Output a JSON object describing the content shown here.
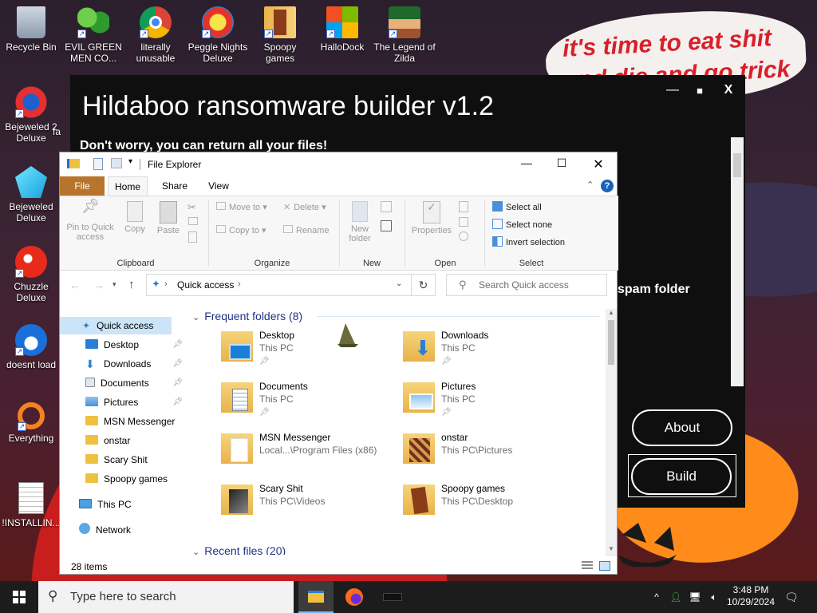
{
  "desktop": {
    "icons": [
      {
        "label": "Recycle Bin",
        "icon": "recycle-bin-icon"
      },
      {
        "label": "EVIL GREEN MEN CO...",
        "icon": "msn-icon"
      },
      {
        "label": "literally unusable",
        "icon": "chrome-icon"
      },
      {
        "label": "Peggle Nights Deluxe",
        "icon": "peggle-icon"
      },
      {
        "label": "Spoopy games",
        "icon": "folder-icon"
      },
      {
        "label": "HalloDock",
        "icon": "windows-logo-icon"
      },
      {
        "label": "The Legend of Zilda",
        "icon": "zelda-icon"
      },
      {
        "label": "Bejeweled 2 Deluxe",
        "icon": "bejeweled2-icon"
      },
      {
        "label": "Bejeweled Deluxe",
        "icon": "bejeweled-icon"
      },
      {
        "label": "Chuzzle Deluxe",
        "icon": "chuzzle-icon"
      },
      {
        "label": "doesnt load",
        "icon": "thunderbird-icon"
      },
      {
        "label": "Everything",
        "icon": "everything-search-icon"
      },
      {
        "label": "!INSTALLIN...",
        "icon": "text-file-icon"
      }
    ],
    "partial_label": "fa",
    "speech_bubble": "it's time to eat shit and die and go trick"
  },
  "ransomware": {
    "title": "Hildaboo ransomware builder v1.2",
    "subtitle": "Don't worry, you can return all your files!",
    "side_text": "spam folder",
    "about_label": "About",
    "build_label": "Build",
    "minimize": "—",
    "maximize": "■",
    "close": "X"
  },
  "explorer": {
    "title": "File Explorer",
    "tabs": {
      "file": "File",
      "home": "Home",
      "share": "Share",
      "view": "View"
    },
    "ribbon": {
      "pin": "Pin to Quick access",
      "copy": "Copy",
      "paste": "Paste",
      "move_to": "Move to",
      "copy_to": "Copy to",
      "delete": "Delete",
      "rename": "Rename",
      "new_folder": "New folder",
      "properties": "Properties",
      "select_all": "Select all",
      "select_none": "Select none",
      "invert_selection": "Invert selection",
      "groups": {
        "clipboard": "Clipboard",
        "organize": "Organize",
        "new": "New",
        "open": "Open",
        "select": "Select"
      }
    },
    "address": "Quick access",
    "search_placeholder": "Search Quick access",
    "nav": {
      "quick_access": "Quick access",
      "items": [
        "Desktop",
        "Downloads",
        "Documents",
        "Pictures",
        "MSN Messenger",
        "onstar",
        "Scary Shit",
        "Spoopy games"
      ],
      "this_pc": "This PC",
      "network": "Network"
    },
    "content": {
      "frequent_header": "Frequent folders (8)",
      "recent_header": "Recent files (20)",
      "folders": [
        {
          "name": "Desktop",
          "location": "This PC"
        },
        {
          "name": "Downloads",
          "location": "This PC"
        },
        {
          "name": "Documents",
          "location": "This PC"
        },
        {
          "name": "Pictures",
          "location": "This PC"
        },
        {
          "name": "MSN Messenger",
          "location": "Local...\\Program Files (x86)"
        },
        {
          "name": "onstar",
          "location": "This PC\\Pictures"
        },
        {
          "name": "Scary Shit",
          "location": "This PC\\Videos"
        },
        {
          "name": "Spoopy games",
          "location": "This PC\\Desktop"
        }
      ]
    },
    "status": "28 items"
  },
  "taskbar": {
    "search_placeholder": "Type here to search",
    "time": "3:48 PM",
    "date": "10/29/2024"
  }
}
